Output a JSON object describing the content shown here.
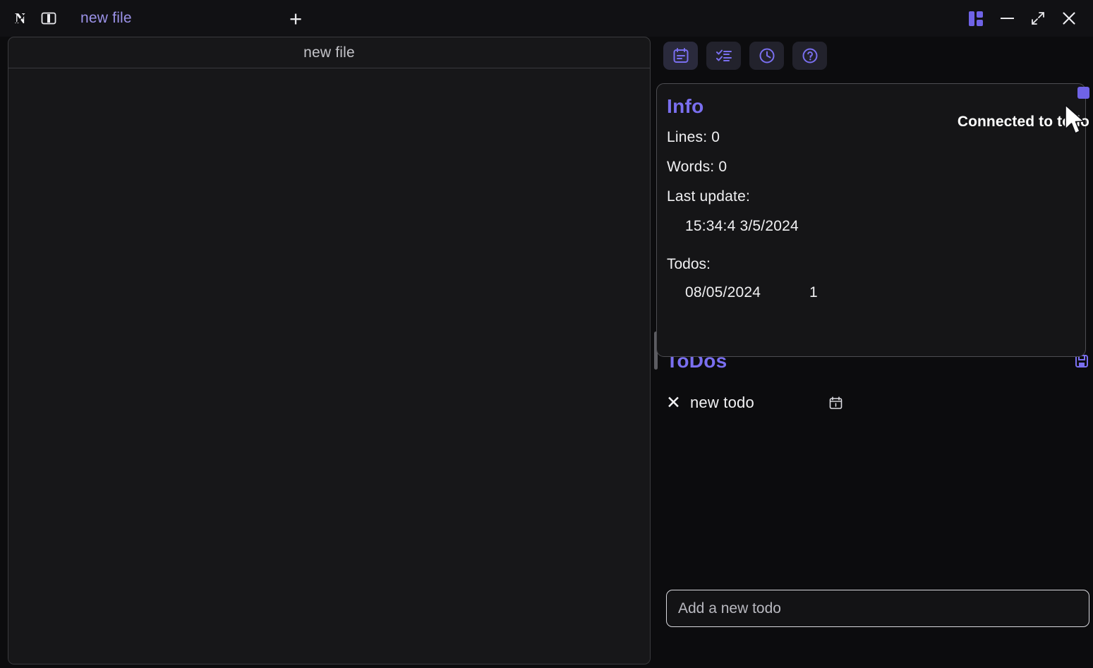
{
  "app": {
    "logo_letter": "N",
    "accent_color": "#6f63e6",
    "background_color": "#0c0c0e"
  },
  "titlebar": {
    "logo_name": "notes-logo",
    "panel_toggle_name": "toggle-sidebar",
    "tabs": [
      {
        "label": "new file",
        "active": true
      }
    ],
    "add_tab_label": "+",
    "window_controls": {
      "layout_label": "",
      "minimize_label": "",
      "maximize_label": "↗",
      "close_label": "✕"
    }
  },
  "editor": {
    "title": "new file",
    "content": "",
    "placeholder": ""
  },
  "sidebar": {
    "toolbar": [
      {
        "id": "notes",
        "icon": "calendar-note-icon",
        "active": true
      },
      {
        "id": "tasks",
        "icon": "checklist-icon",
        "active": false
      },
      {
        "id": "history",
        "icon": "clock-icon",
        "active": false
      },
      {
        "id": "help",
        "icon": "question-circle-icon",
        "active": false
      }
    ],
    "info_card": {
      "title": "Info",
      "lines_label": "Lines: 0",
      "words_label": "Words: 0",
      "last_update_label": "Last update:",
      "last_update_value": "15:34:4  3/5/2024",
      "todos_label": "Todos:",
      "todo_rows": [
        {
          "date": "08/05/2024",
          "count": "1"
        }
      ],
      "connection_status": "Connected to todo",
      "connection_icon": "connected-square-icon"
    },
    "todos": {
      "title": "ToDos",
      "action_icon": "save-todos-icon",
      "items": [
        {
          "remove_label": "✕",
          "label": "new todo",
          "date_icon": "calendar-icon"
        }
      ],
      "add_placeholder": "Add a new todo",
      "add_value": ""
    }
  }
}
